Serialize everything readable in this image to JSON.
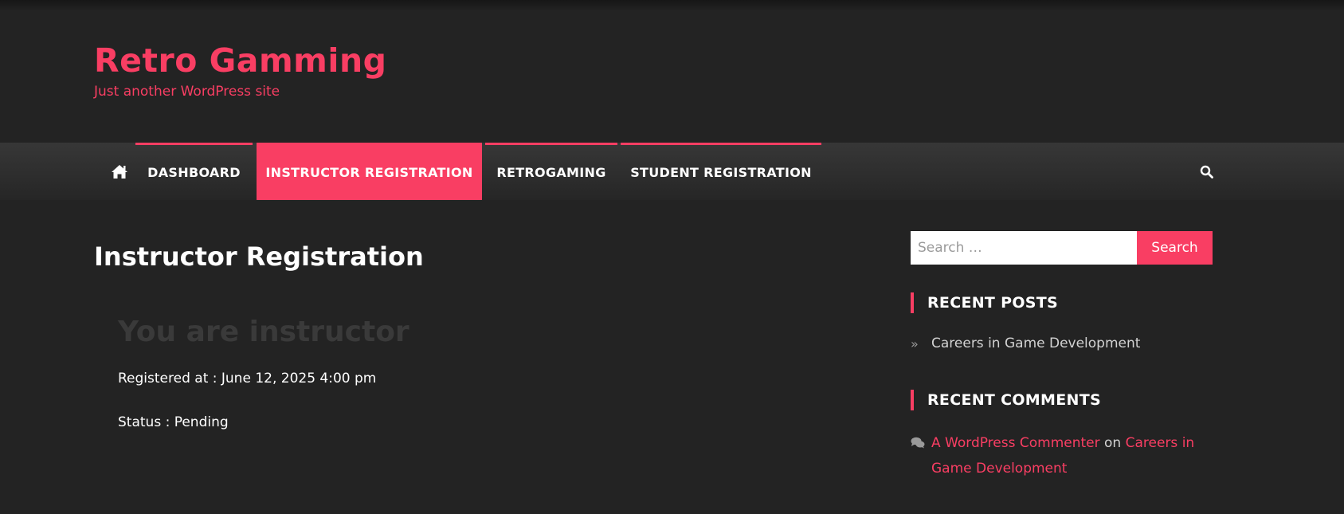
{
  "site": {
    "title": "Retro Gamming",
    "tagline": "Just another WordPress site"
  },
  "nav": {
    "home_icon": "home-icon",
    "search_icon": "search-icon",
    "items": [
      {
        "label": "DASHBOARD",
        "active": false
      },
      {
        "label": "INSTRUCTOR REGISTRATION",
        "active": true
      },
      {
        "label": "RETROGAMING",
        "active": false
      },
      {
        "label": "STUDENT REGISTRATION",
        "active": false
      }
    ]
  },
  "main": {
    "page_title": "Instructor Registration",
    "status_heading": "You are instructor",
    "registered_at": "Registered at : June 12, 2025 4:00 pm",
    "status": "Status : Pending"
  },
  "sidebar": {
    "search": {
      "placeholder": "Search …",
      "button_label": "Search"
    },
    "recent_posts": {
      "title": "RECENT POSTS",
      "items": [
        "Careers in Game Development"
      ]
    },
    "recent_comments": {
      "title": "RECENT COMMENTS",
      "author": "A WordPress Commenter",
      "connector": "on",
      "post": "Careers in Game Development"
    }
  },
  "colors": {
    "accent": "#f93e63",
    "background": "#232323",
    "nav_background": "#2f2f2f"
  }
}
